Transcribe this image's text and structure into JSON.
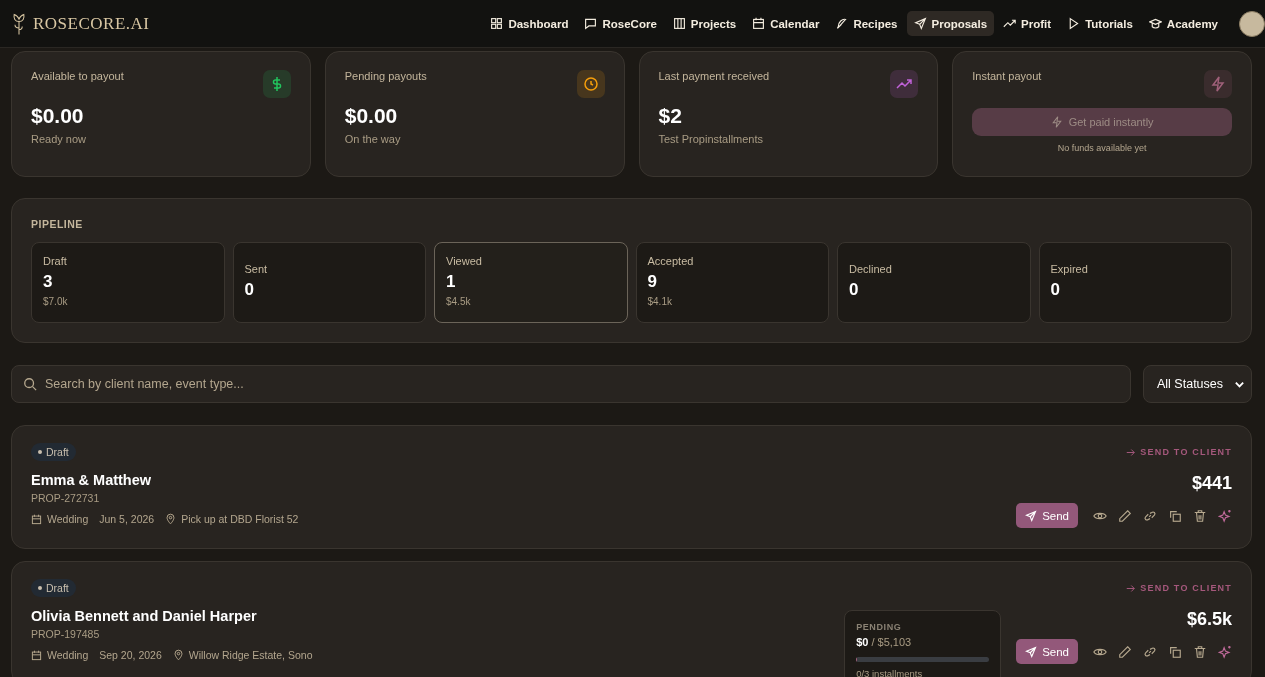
{
  "brand": {
    "name": "ROSECORE.AI"
  },
  "nav": [
    {
      "label": "Dashboard",
      "selected": false
    },
    {
      "label": "RoseCore",
      "selected": false
    },
    {
      "label": "Projects",
      "selected": false
    },
    {
      "label": "Calendar",
      "selected": false
    },
    {
      "label": "Recipes",
      "selected": false
    },
    {
      "label": "Proposals",
      "selected": true
    },
    {
      "label": "Profit",
      "selected": false
    },
    {
      "label": "Tutorials",
      "selected": false
    },
    {
      "label": "Academy",
      "selected": false
    }
  ],
  "stats": [
    {
      "kind": "stat",
      "label": "Available to payout",
      "value": "$0.00",
      "note": "Ready now",
      "color": "#22c55e"
    },
    {
      "kind": "stat",
      "label": "Pending payouts",
      "value": "$0.00",
      "note": "On the way",
      "color": "#f59e0b"
    },
    {
      "kind": "stat",
      "label": "Last payment received",
      "value": "$2",
      "note": "Test Propinstallments",
      "color": "#c062d8"
    },
    {
      "kind": "instant",
      "label": "Instant payout",
      "button": "Get paid instantly",
      "disabled": true,
      "note": "No funds available yet",
      "color": "#a0607a"
    }
  ],
  "pipeline": {
    "title": "PIPELINE",
    "stages": [
      {
        "label": "Draft",
        "count": "3",
        "amount": "$7.0k",
        "selected": false
      },
      {
        "label": "Sent",
        "count": "0",
        "selected": false
      },
      {
        "label": "Viewed",
        "count": "1",
        "amount": "$4.5k",
        "selected": true
      },
      {
        "label": "Accepted",
        "count": "9",
        "amount": "$4.1k",
        "selected": false
      },
      {
        "label": "Declined",
        "count": "0",
        "selected": false
      },
      {
        "label": "Expired",
        "count": "0",
        "selected": false
      }
    ]
  },
  "search": {
    "placeholder": "Search by client name, event type..."
  },
  "filter": {
    "value": "All Statuses"
  },
  "proposals": [
    {
      "status": "Draft",
      "name": "Emma & Matthew",
      "id": "PROP-272731",
      "event": "Wedding",
      "date": "Jun 5, 2026",
      "location": "Pick up at DBD Florist 52",
      "action": "SEND TO CLIENT",
      "amount": "$441",
      "send": "Send"
    },
    {
      "status": "Draft",
      "name": "Olivia Bennett and Daniel Harper",
      "id": "PROP-197485",
      "event": "Wedding",
      "date": "Sep 20, 2026",
      "location": "Willow Ridge Estate, Sono",
      "action": "SEND TO CLIENT",
      "amount": "$6.5k",
      "send": "Send",
      "payment": {
        "label": "PENDING",
        "paid": "$0",
        "total": "/ $5,103",
        "level": 0,
        "installments": "0/3 installments"
      }
    }
  ]
}
